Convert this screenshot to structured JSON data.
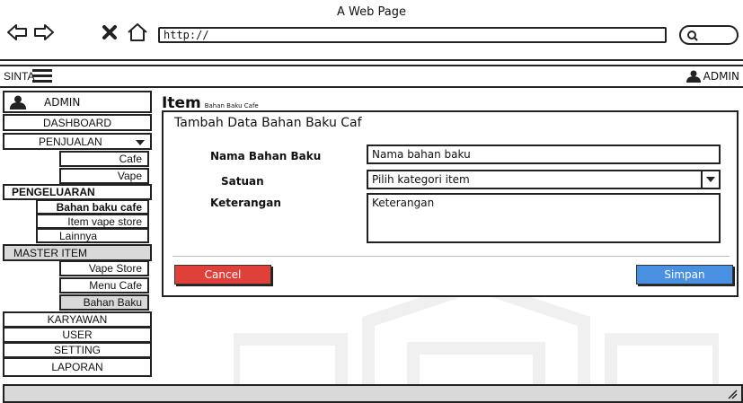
{
  "window": {
    "title": "A Web Page"
  },
  "browser": {
    "url": "http://"
  },
  "appbar": {
    "app_name": "SINTA",
    "user": "ADMIN"
  },
  "sidebar": {
    "user": "ADMIN",
    "items": [
      {
        "label": "DASHBOARD"
      },
      {
        "label": "PENJUALAN"
      },
      {
        "label": "Cafe"
      },
      {
        "label": "Vape"
      },
      {
        "label": "PENGELUARAN"
      },
      {
        "label": "Bahan baku cafe"
      },
      {
        "label": "Item vape store"
      },
      {
        "label": "Lainnya"
      },
      {
        "label": "MASTER ITEM"
      },
      {
        "label": "Vape Store"
      },
      {
        "label": "Menu Cafe"
      },
      {
        "label": "Bahan Baku"
      },
      {
        "label": "KARYAWAN"
      },
      {
        "label": "USER"
      },
      {
        "label": "SETTING"
      },
      {
        "label": "LAPORAN"
      }
    ]
  },
  "main": {
    "title": "Item",
    "subtitle": "Bahan Baku Cafe",
    "card_title": "Tambah Data Bahan Baku Caf",
    "form": {
      "name_label": "Nama Bahan Baku",
      "name_value": "Nama bahan baku",
      "unit_label": "Satuan",
      "unit_value": "Pilih kategori item",
      "note_label": "Keterangan",
      "note_value": "Keterangan"
    },
    "cancel_label": "Cancel",
    "save_label": "Simpan"
  },
  "colors": {
    "cancel": "#e0403a",
    "save": "#4a90e2",
    "selected": "#d9d9d9"
  }
}
